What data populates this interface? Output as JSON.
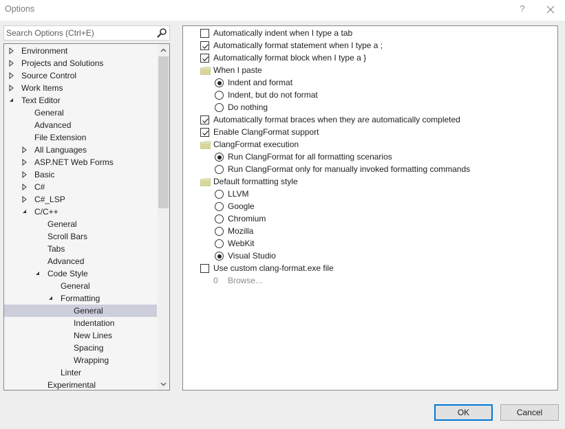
{
  "window": {
    "title": "Options",
    "help_label": "?",
    "close_icon": "close-icon"
  },
  "search": {
    "placeholder": "Search Options (Ctrl+E)",
    "value": "",
    "icon": "search-icon"
  },
  "tree": {
    "items": [
      {
        "label": "Environment",
        "level": 0,
        "state": "collapsed"
      },
      {
        "label": "Projects and Solutions",
        "level": 0,
        "state": "collapsed"
      },
      {
        "label": "Source Control",
        "level": 0,
        "state": "collapsed"
      },
      {
        "label": "Work Items",
        "level": 0,
        "state": "collapsed"
      },
      {
        "label": "Text Editor",
        "level": 0,
        "state": "expanded"
      },
      {
        "label": "General",
        "level": 1,
        "state": "leaf"
      },
      {
        "label": "Advanced",
        "level": 1,
        "state": "leaf"
      },
      {
        "label": "File Extension",
        "level": 1,
        "state": "leaf"
      },
      {
        "label": "All Languages",
        "level": 1,
        "state": "collapsed"
      },
      {
        "label": "ASP.NET Web Forms",
        "level": 1,
        "state": "collapsed"
      },
      {
        "label": "Basic",
        "level": 1,
        "state": "collapsed"
      },
      {
        "label": "C#",
        "level": 1,
        "state": "collapsed"
      },
      {
        "label": "C#_LSP",
        "level": 1,
        "state": "collapsed"
      },
      {
        "label": "C/C++",
        "level": 1,
        "state": "expanded"
      },
      {
        "label": "General",
        "level": 2,
        "state": "leaf"
      },
      {
        "label": "Scroll Bars",
        "level": 2,
        "state": "leaf"
      },
      {
        "label": "Tabs",
        "level": 2,
        "state": "leaf"
      },
      {
        "label": "Advanced",
        "level": 2,
        "state": "leaf"
      },
      {
        "label": "Code Style",
        "level": 2,
        "state": "expanded"
      },
      {
        "label": "General",
        "level": 3,
        "state": "leaf"
      },
      {
        "label": "Formatting",
        "level": 3,
        "state": "expanded"
      },
      {
        "label": "General",
        "level": 4,
        "state": "leaf",
        "selected": true
      },
      {
        "label": "Indentation",
        "level": 4,
        "state": "leaf"
      },
      {
        "label": "New Lines",
        "level": 4,
        "state": "leaf"
      },
      {
        "label": "Spacing",
        "level": 4,
        "state": "leaf"
      },
      {
        "label": "Wrapping",
        "level": 4,
        "state": "leaf"
      },
      {
        "label": "Linter",
        "level": 3,
        "state": "leaf"
      },
      {
        "label": "Experimental",
        "level": 2,
        "state": "leaf"
      }
    ],
    "scroll_up_icon": "chevron-up-icon",
    "scroll_down_icon": "chevron-down-icon"
  },
  "options": [
    {
      "type": "checkbox",
      "label": "Automatically indent when I type a tab",
      "checked": false,
      "indent": 0
    },
    {
      "type": "checkbox",
      "label": "Automatically format statement when I type a ;",
      "checked": true,
      "indent": 0
    },
    {
      "type": "checkbox",
      "label": "Automatically format block when I type a }",
      "checked": true,
      "indent": 0
    },
    {
      "type": "group",
      "label": "When I paste",
      "indent": 0
    },
    {
      "type": "radio",
      "label": "Indent and format",
      "checked": true,
      "indent": 1
    },
    {
      "type": "radio",
      "label": "Indent, but do not format",
      "checked": false,
      "indent": 1
    },
    {
      "type": "radio",
      "label": "Do nothing",
      "checked": false,
      "indent": 1
    },
    {
      "type": "checkbox",
      "label": "Automatically format braces when they are automatically completed",
      "checked": true,
      "indent": 0
    },
    {
      "type": "checkbox",
      "label": "Enable ClangFormat support",
      "checked": true,
      "indent": 0
    },
    {
      "type": "group",
      "label": "ClangFormat execution",
      "indent": 0
    },
    {
      "type": "radio",
      "label": "Run ClangFormat for all formatting scenarios",
      "checked": true,
      "indent": 1
    },
    {
      "type": "radio",
      "label": "Run ClangFormat only for manually invoked formatting commands",
      "checked": false,
      "indent": 1
    },
    {
      "type": "group",
      "label": "Default formatting style",
      "indent": 0
    },
    {
      "type": "radio",
      "label": "LLVM",
      "checked": false,
      "indent": 1
    },
    {
      "type": "radio",
      "label": "Google",
      "checked": false,
      "indent": 1
    },
    {
      "type": "radio",
      "label": "Chromium",
      "checked": false,
      "indent": 1
    },
    {
      "type": "radio",
      "label": "Mozilla",
      "checked": false,
      "indent": 1
    },
    {
      "type": "radio",
      "label": "WebKit",
      "checked": false,
      "indent": 1
    },
    {
      "type": "radio",
      "label": "Visual Studio",
      "checked": true,
      "indent": 1
    },
    {
      "type": "checkbox",
      "label": "Use custom clang-format.exe file",
      "checked": false,
      "indent": 0
    },
    {
      "type": "browse",
      "prefix": "0",
      "label": "Browse...",
      "indent": 0,
      "disabled": true
    }
  ],
  "buttons": {
    "ok": "OK",
    "cancel": "Cancel"
  },
  "colors": {
    "accent": "#0078d7",
    "selection": "#cccedb",
    "folder": "#d6d69a"
  }
}
